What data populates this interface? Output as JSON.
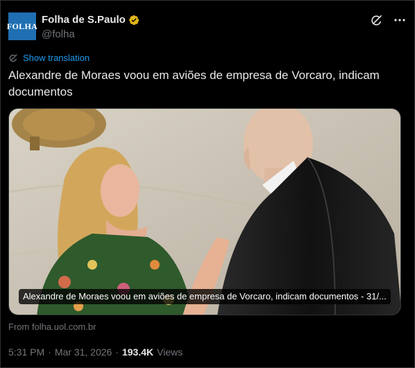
{
  "account": {
    "display_name": "Folha de S.Paulo",
    "handle": "@folha",
    "avatar_text": "FOLHA",
    "verified": true
  },
  "header_icons": [
    "grok-icon",
    "more-icon"
  ],
  "translate": {
    "label": "Show translation"
  },
  "tweet": {
    "text": "Alexandre de Moraes voou em aviões de empresa de Vorcaro, indicam documentos"
  },
  "card": {
    "title": "Alexandre de Moraes voou em aviões de empresa de Vorcaro, indicam documentos - 31/...",
    "source": "From folha.uol.com.br"
  },
  "meta": {
    "time": "5:31 PM",
    "separator": "·",
    "date": "Mar 31, 2026",
    "views_count": "193.4K",
    "views_label": "Views"
  },
  "colors": {
    "background": "#000000",
    "link": "#1d9bf0",
    "muted": "#71767b",
    "verified_badge": "#e2b719",
    "avatar_bg": "#1f6fb2"
  }
}
